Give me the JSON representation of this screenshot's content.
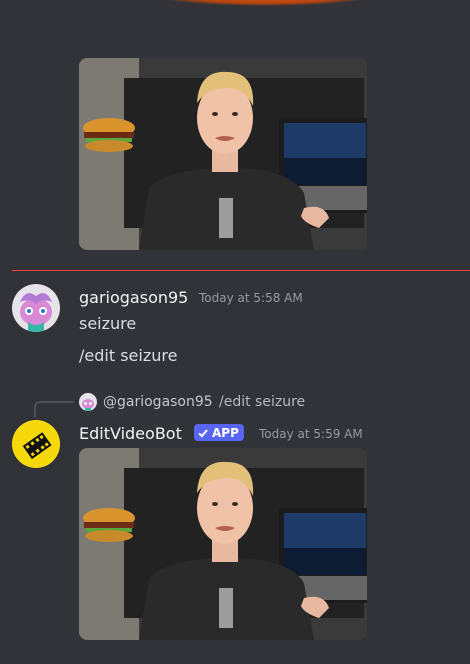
{
  "messages": {
    "first": {
      "username": "gariogason95",
      "timestamp": "Today at 5:58 AM",
      "lines": [
        "seizure",
        "/edit seizure"
      ]
    },
    "bot": {
      "reply": {
        "mention": "@gariogason95",
        "content": "/edit seizure"
      },
      "username": "EditVideoBot",
      "badge": "APP",
      "timestamp": "Today at 5:59 AM"
    }
  },
  "colors": {
    "background": "#313338",
    "new_messages_divider": "#f23f43",
    "app_badge": "#5865f2",
    "bot_avatar": "#f5d90a"
  },
  "icons": {
    "badge_check": "checkmark-icon",
    "bot_avatar": "film-clapper-icon"
  }
}
